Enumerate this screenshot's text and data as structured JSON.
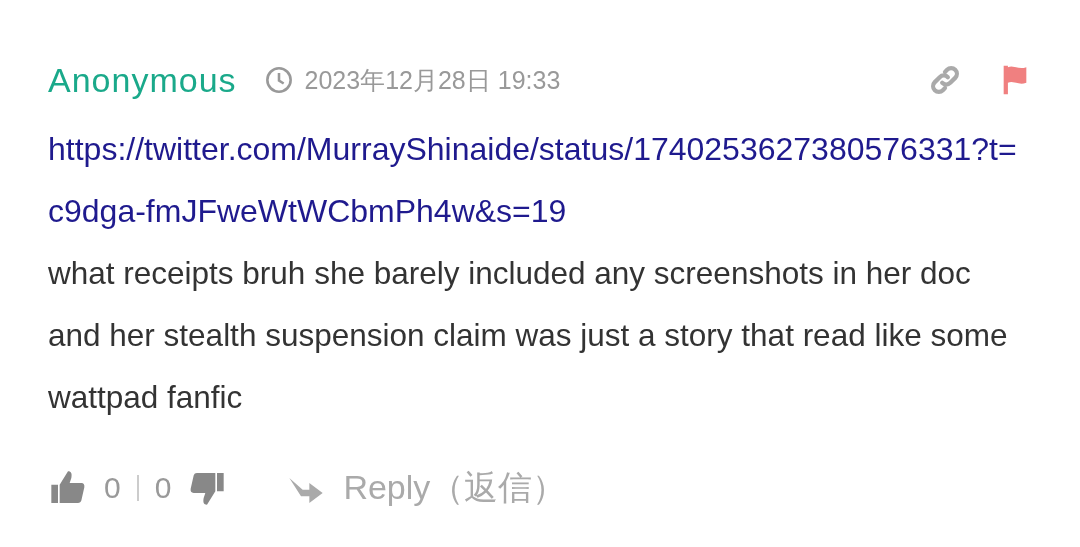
{
  "comment": {
    "author": "Anonymous",
    "time": "2023年12月28日 19:33",
    "link": "https://twitter.com/MurrayShinaide/status/1740253627380576331?t=c9dga-fmJFweWtWCbmPh4w&s=19",
    "text": "what receipts bruh she barely included any screenshots in her doc and her stealth suspension claim was just a story that read like some wattpad fanfic",
    "likes": "0",
    "dislikes": "0",
    "reply": "Reply（返信）"
  }
}
